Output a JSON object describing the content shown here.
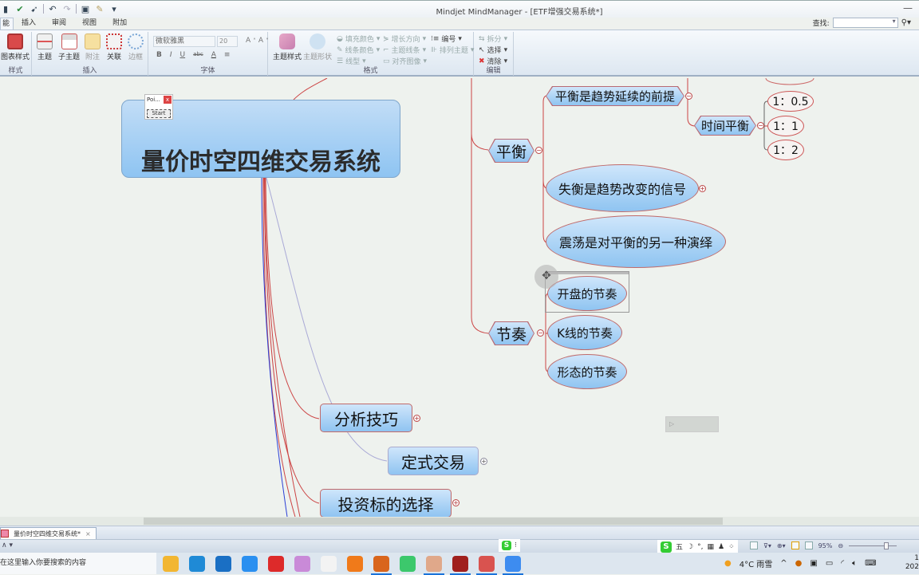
{
  "window": {
    "title": "Mindjet MindManager - [ETF增强交易系统*]",
    "minimize_glyph": "—"
  },
  "quick_access": {
    "icons": [
      "save-icon",
      "check-icon",
      "send-icon",
      "undo-icon",
      "redo-icon",
      "help-icon",
      "brush-icon",
      "customize-icon"
    ]
  },
  "ribbon_tabs": [
    {
      "label": "能",
      "active": true
    },
    {
      "label": "插入",
      "active": false
    },
    {
      "label": "审阅",
      "active": false
    },
    {
      "label": "视图",
      "active": false
    },
    {
      "label": "附加",
      "active": false
    }
  ],
  "find": {
    "label": "查找:",
    "value": ""
  },
  "ribbon": {
    "groups": {
      "style": "样式",
      "insert": "插入",
      "font": "字体",
      "format": "格式",
      "edit": "编辑"
    },
    "style_buttons": {
      "map_style": "图表样式"
    },
    "insert_buttons": {
      "topic": "主题",
      "subtopic": "子主题",
      "callout": "附注",
      "relationship": "关联",
      "boundary": "边框"
    },
    "font": {
      "family": "微软雅黑",
      "size": "20",
      "bold": "B",
      "italic": "I",
      "underline": "U",
      "strike": "abc",
      "color": "A",
      "align": "≡"
    },
    "format_buttons": {
      "topic_style": "主题样式",
      "topic_shape": "主题形状",
      "fill_color": "填充颜色",
      "line_color": "线条颜色",
      "line_style": "线型",
      "growth_direction": "增长方向",
      "topic_lines": "主题线条",
      "align_images": "对齐图像",
      "numbering": "编号",
      "arrange_topics": "排列主题"
    },
    "edit_buttons": {
      "split": "拆分",
      "select": "选择",
      "delete": "清除"
    }
  },
  "mindmap": {
    "central_topic": "量价时空四维交易系统",
    "branches": {
      "balance": {
        "label": "平衡",
        "children": [
          {
            "label": "平衡是趋势延续的前提"
          },
          {
            "label": "失衡是趋势改变的信号"
          },
          {
            "label": "震荡是对平衡的另一种演绎"
          }
        ],
        "time_balance": {
          "label": "时间平衡",
          "ratios": [
            "1：0.5",
            "1：1",
            "1：2"
          ]
        }
      },
      "rhythm": {
        "label": "节奏",
        "children": [
          {
            "label": "开盘的节奏"
          },
          {
            "label": "K线的节奏"
          },
          {
            "label": "形态的节奏"
          }
        ]
      },
      "analysis": {
        "label": "分析技巧"
      },
      "formula": {
        "label": "定式交易"
      },
      "target": {
        "label": "投资标的选择"
      }
    },
    "collapse_minus": "−",
    "expand_plus": "+"
  },
  "popup": {
    "title": "Poi...",
    "close": "x",
    "button": "Start"
  },
  "ghost_label": "▷",
  "doc_tab": {
    "label": "量价时空四维交易系统*",
    "close": "×"
  },
  "statusbar": {
    "left": "∧ ▾",
    "ime_mini": "S",
    "ime_items": [
      "五",
      "☽",
      "°,",
      "▦",
      "♟",
      "⁘"
    ],
    "zoom_percent": "95%"
  },
  "taskbar": {
    "search_placeholder": "在这里输入你要搜索的内容",
    "apps": [
      {
        "name": "file-explorer",
        "color": "#f2b632",
        "active": false
      },
      {
        "name": "edge",
        "color": "#1f8ad6",
        "active": false
      },
      {
        "name": "mail",
        "color": "#1a6fc4",
        "active": false
      },
      {
        "name": "app-blue-l",
        "color": "#2a8ff0",
        "active": false
      },
      {
        "name": "app-red",
        "color": "#dd2a2a",
        "active": false
      },
      {
        "name": "snipping",
        "color": "#c98ad8",
        "active": false
      },
      {
        "name": "notepad",
        "color": "#f3f3f3",
        "active": false
      },
      {
        "name": "app-orange",
        "color": "#f07a1a",
        "active": false
      },
      {
        "name": "app-monkey",
        "color": "#d9651c",
        "active": true
      },
      {
        "name": "wechat",
        "color": "#3cc86c",
        "active": false
      },
      {
        "name": "app-map",
        "color": "#e0a88a",
        "active": true
      },
      {
        "name": "app-wh6",
        "color": "#a0201e",
        "active": true
      },
      {
        "name": "mindmanager",
        "color": "#d9534f",
        "active": true
      },
      {
        "name": "chrome-like",
        "color": "#3d8cf0",
        "active": true
      }
    ],
    "weather": "4°C 雨雪",
    "clock_time": "1",
    "clock_date": "202"
  }
}
